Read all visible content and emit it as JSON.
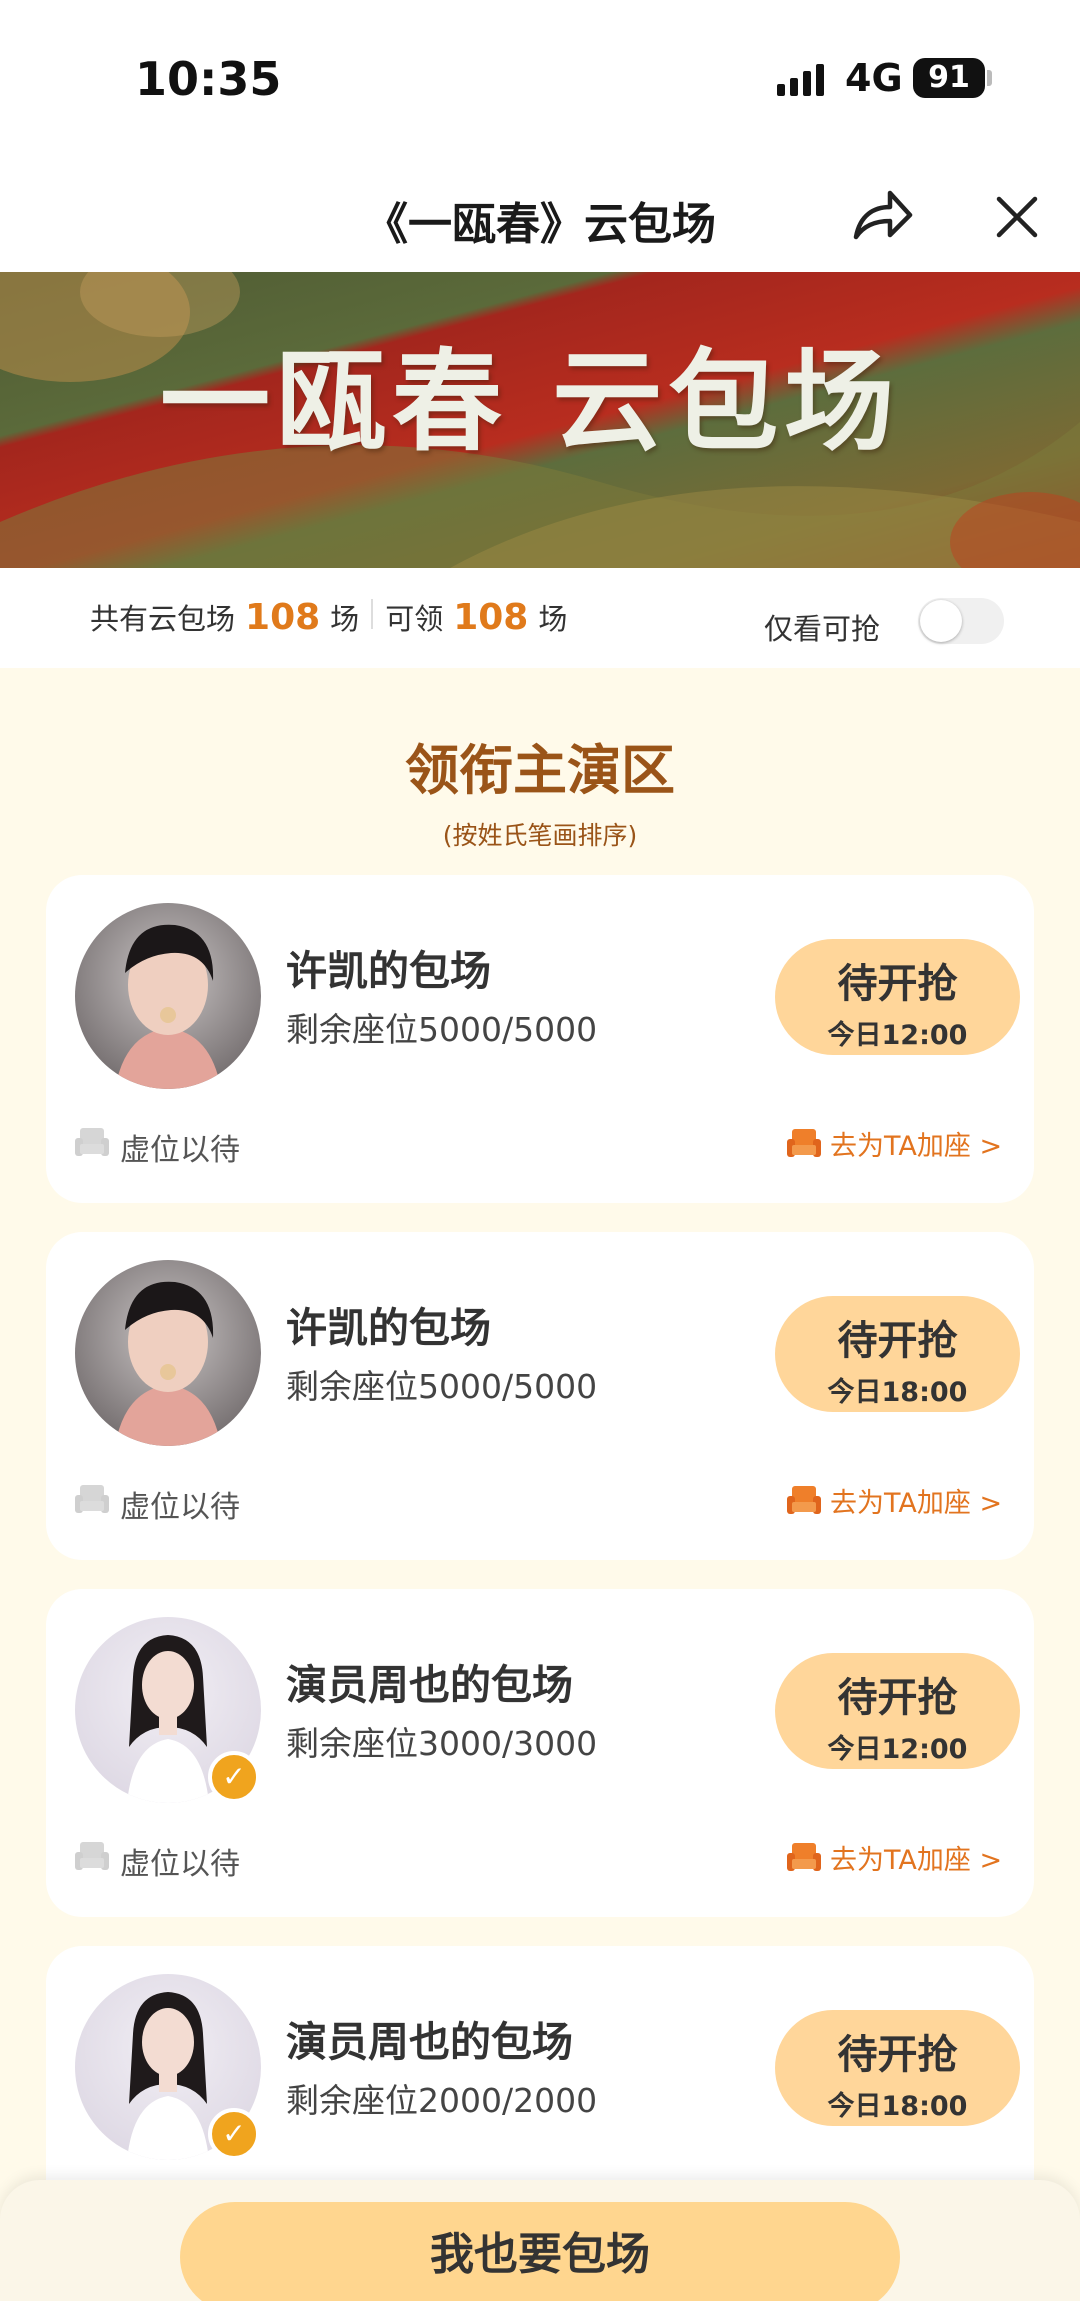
{
  "status_bar": {
    "time": "10:35",
    "network": "4G",
    "battery": "91"
  },
  "nav": {
    "title": "《一瓯春》云包场"
  },
  "banner": {
    "title": "一瓯春 云包场"
  },
  "stats": {
    "total_prefix": "共有云包场",
    "total_count": "108",
    "total_unit": "场",
    "claim_prefix": "可领",
    "claim_count": "108",
    "claim_unit": "场",
    "toggle_label": "仅看可抢",
    "toggle_on": false
  },
  "section": {
    "title": "领衔主演区",
    "subtitle": "(按姓氏笔画排序)"
  },
  "cards": [
    {
      "name": "许凯的包场",
      "seats": "剩余座位5000/5000",
      "button_label": "待开抢",
      "button_time": "今日12:00",
      "vacant": "虚位以待",
      "add_seat": "去为TA加座 >",
      "verified": false
    },
    {
      "name": "许凯的包场",
      "seats": "剩余座位5000/5000",
      "button_label": "待开抢",
      "button_time": "今日18:00",
      "vacant": "虚位以待",
      "add_seat": "去为TA加座 >",
      "verified": false
    },
    {
      "name": "演员周也的包场",
      "seats": "剩余座位3000/3000",
      "button_label": "待开抢",
      "button_time": "今日12:00",
      "vacant": "虚位以待",
      "add_seat": "去为TA加座 >",
      "verified": true
    },
    {
      "name": "演员周也的包场",
      "seats": "剩余座位2000/2000",
      "button_label": "待开抢",
      "button_time": "今日18:00",
      "vacant": "",
      "add_seat": "",
      "verified": true
    }
  ],
  "bottom": {
    "button_label": "我也要包场"
  },
  "colors": {
    "accent": "#e07a1b",
    "section": "#9a5418",
    "button": "#ffd69a",
    "background": "#fffaea"
  },
  "icons": [
    "signal-icon",
    "battery-icon",
    "share-icon",
    "close-icon",
    "sofa-icon",
    "verified-icon"
  ]
}
